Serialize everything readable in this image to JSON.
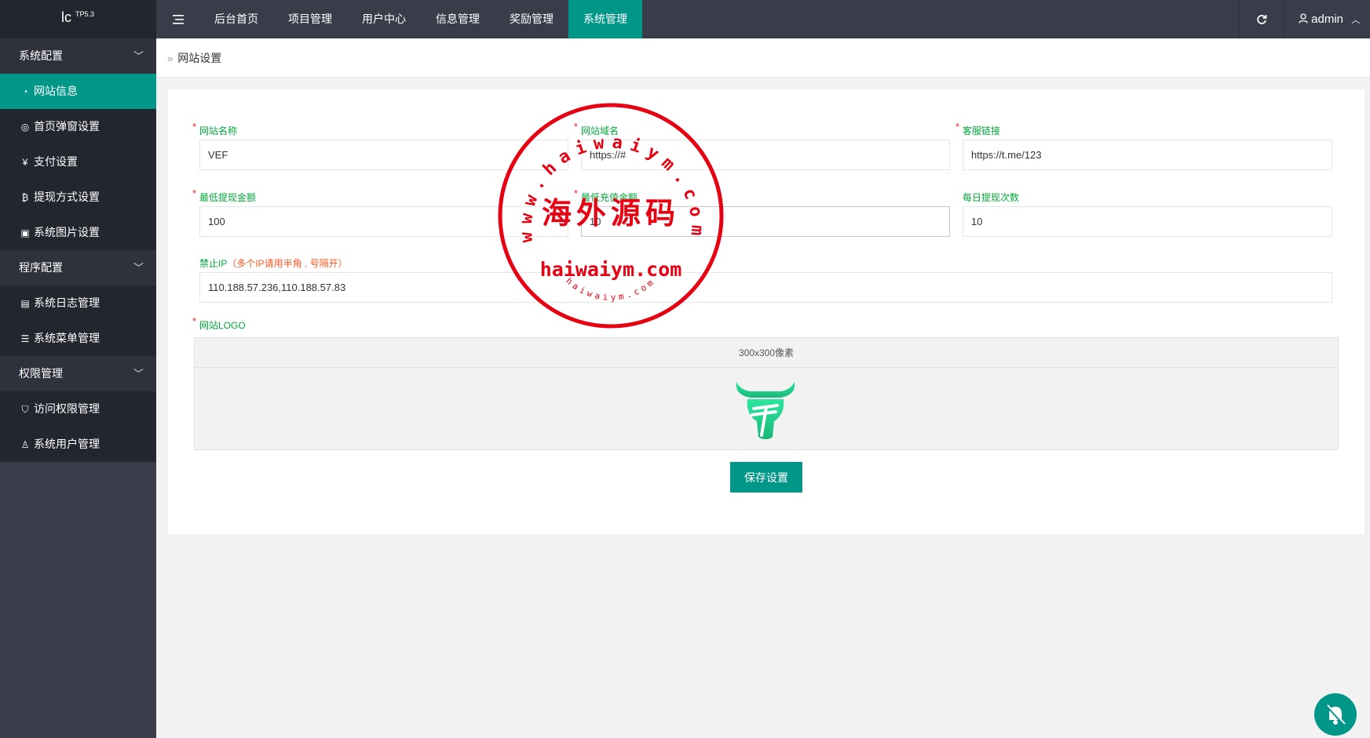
{
  "app": {
    "logo_text": "lc",
    "logo_sup": "TP5.3"
  },
  "nav": {
    "menu_icon": "hamburger-icon",
    "items": [
      {
        "label": "后台首页"
      },
      {
        "label": "项目管理"
      },
      {
        "label": "用户中心"
      },
      {
        "label": "信息管理"
      },
      {
        "label": "奖励管理"
      },
      {
        "label": "系统管理",
        "active": true
      }
    ],
    "refresh_icon": "refresh-icon",
    "user": {
      "icon": "user-icon",
      "name": "admin"
    }
  },
  "sidebar": {
    "groups": [
      {
        "label": "系统配置",
        "items": [
          {
            "label": "网站信息",
            "icon": "gauge-icon",
            "active": true
          },
          {
            "label": "首页弹窗设置",
            "icon": "eye-icon"
          },
          {
            "label": "支付设置",
            "icon": "yen-icon"
          },
          {
            "label": "提现方式设置",
            "icon": "bitcoin-icon"
          },
          {
            "label": "系统图片设置",
            "icon": "image-icon"
          }
        ]
      },
      {
        "label": "程序配置",
        "items": [
          {
            "label": "系统日志管理",
            "icon": "log-icon"
          },
          {
            "label": "系统菜单管理",
            "icon": "menu-list-icon"
          }
        ]
      },
      {
        "label": "权限管理",
        "items": [
          {
            "label": "访问权限管理",
            "icon": "shield-icon"
          },
          {
            "label": "系统用户管理",
            "icon": "user-icon"
          }
        ]
      }
    ]
  },
  "breadcrumb": {
    "current": "网站设置"
  },
  "form": {
    "site_name": {
      "label": "网站名称",
      "value": "VEF"
    },
    "site_domain": {
      "label": "网站域名",
      "value": "https://#"
    },
    "service_link": {
      "label": "客服链接",
      "value": "https://t.me/123"
    },
    "min_withdraw": {
      "label": "最低提现金额",
      "value": "100"
    },
    "min_recharge": {
      "label": "最低充值金额",
      "value": "10"
    },
    "daily_withdraw": {
      "label": "每日提现次数",
      "value": "10"
    },
    "ban_ip": {
      "label": "禁止IP",
      "hint": "（多个IP请用半角 , 号隔开）",
      "value": "110.188.57.236,110.188.57.83"
    },
    "site_logo": {
      "label": "网站LOGO",
      "size_hint": "300x300像素",
      "image": "bull-logo"
    }
  },
  "save_label": "保存设置",
  "watermark": {
    "top_arc": "www.haiwaiym.com",
    "center": "海外源码",
    "domain": "haiwaiym.com",
    "bottom_arc": "haiwaiym.com"
  },
  "float_button_icon": "bell-off-icon",
  "colors": {
    "accent": "#009688",
    "topbar": "#393d49",
    "sidebar_dark": "#23262e",
    "label_green": "#01aa3a",
    "required_red": "#ff2222",
    "stamp_red": "#e60012"
  }
}
